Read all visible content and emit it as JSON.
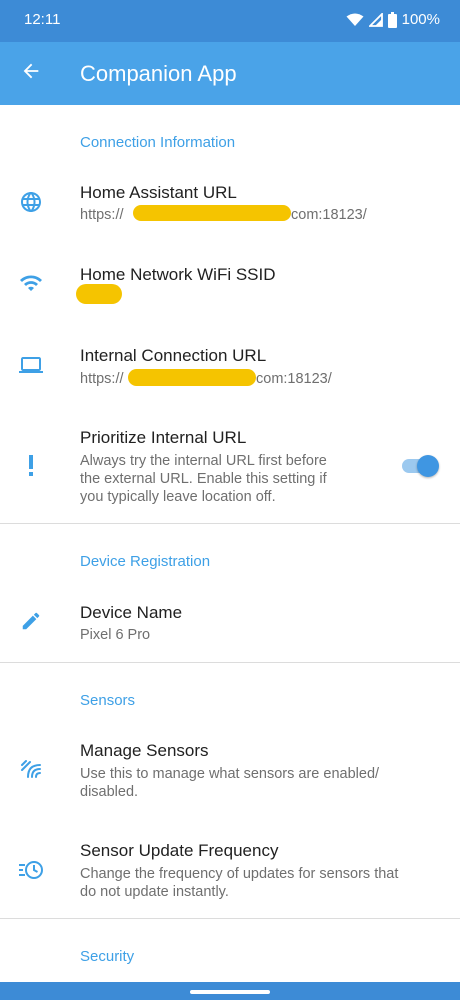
{
  "status_bar": {
    "time": "12:11",
    "battery": "100%",
    "icons": [
      "wifi-icon",
      "signal-icon",
      "battery-icon"
    ]
  },
  "app_bar": {
    "title": "Companion App",
    "back_icon": "arrow-back-icon"
  },
  "sections": {
    "connection": {
      "header": "Connection Information",
      "ha_url": {
        "title": "Home Assistant URL",
        "value_prefix": "https://",
        "value_suffix": "com:18123/",
        "icon": "globe-icon"
      },
      "ssid": {
        "title": "Home Network WiFi SSID",
        "icon": "wifi-icon"
      },
      "internal_url": {
        "title": "Internal Connection URL",
        "value_prefix": "https://",
        "value_suffix": "com:18123/",
        "icon": "laptop-icon"
      },
      "prioritize": {
        "title": "Prioritize Internal URL",
        "line1": "Always try the internal URL first before",
        "line2": "the external URL. Enable this setting if",
        "line3": "you typically leave location off.",
        "enabled": true,
        "icon": "exclamation-icon"
      }
    },
    "device": {
      "header": "Device Registration",
      "device_name": {
        "title": "Device Name",
        "value": "Pixel 6 Pro",
        "icon": "pencil-icon"
      }
    },
    "sensors": {
      "header": "Sensors",
      "manage": {
        "title": "Manage Sensors",
        "line1": "Use this to manage what sensors are enabled/",
        "line2": "disabled.",
        "icon": "sensors-icon"
      },
      "frequency": {
        "title": "Sensor Update Frequency",
        "line1": "Change the frequency of updates for sensors that",
        "line2": "do not update instantly.",
        "icon": "update-clock-icon"
      }
    },
    "security": {
      "header": "Security"
    }
  },
  "colors": {
    "status_bar": "#3d8bd6",
    "app_bar": "#4aa3e8",
    "accent": "#3ea0e6",
    "redaction": "#f5c400"
  }
}
